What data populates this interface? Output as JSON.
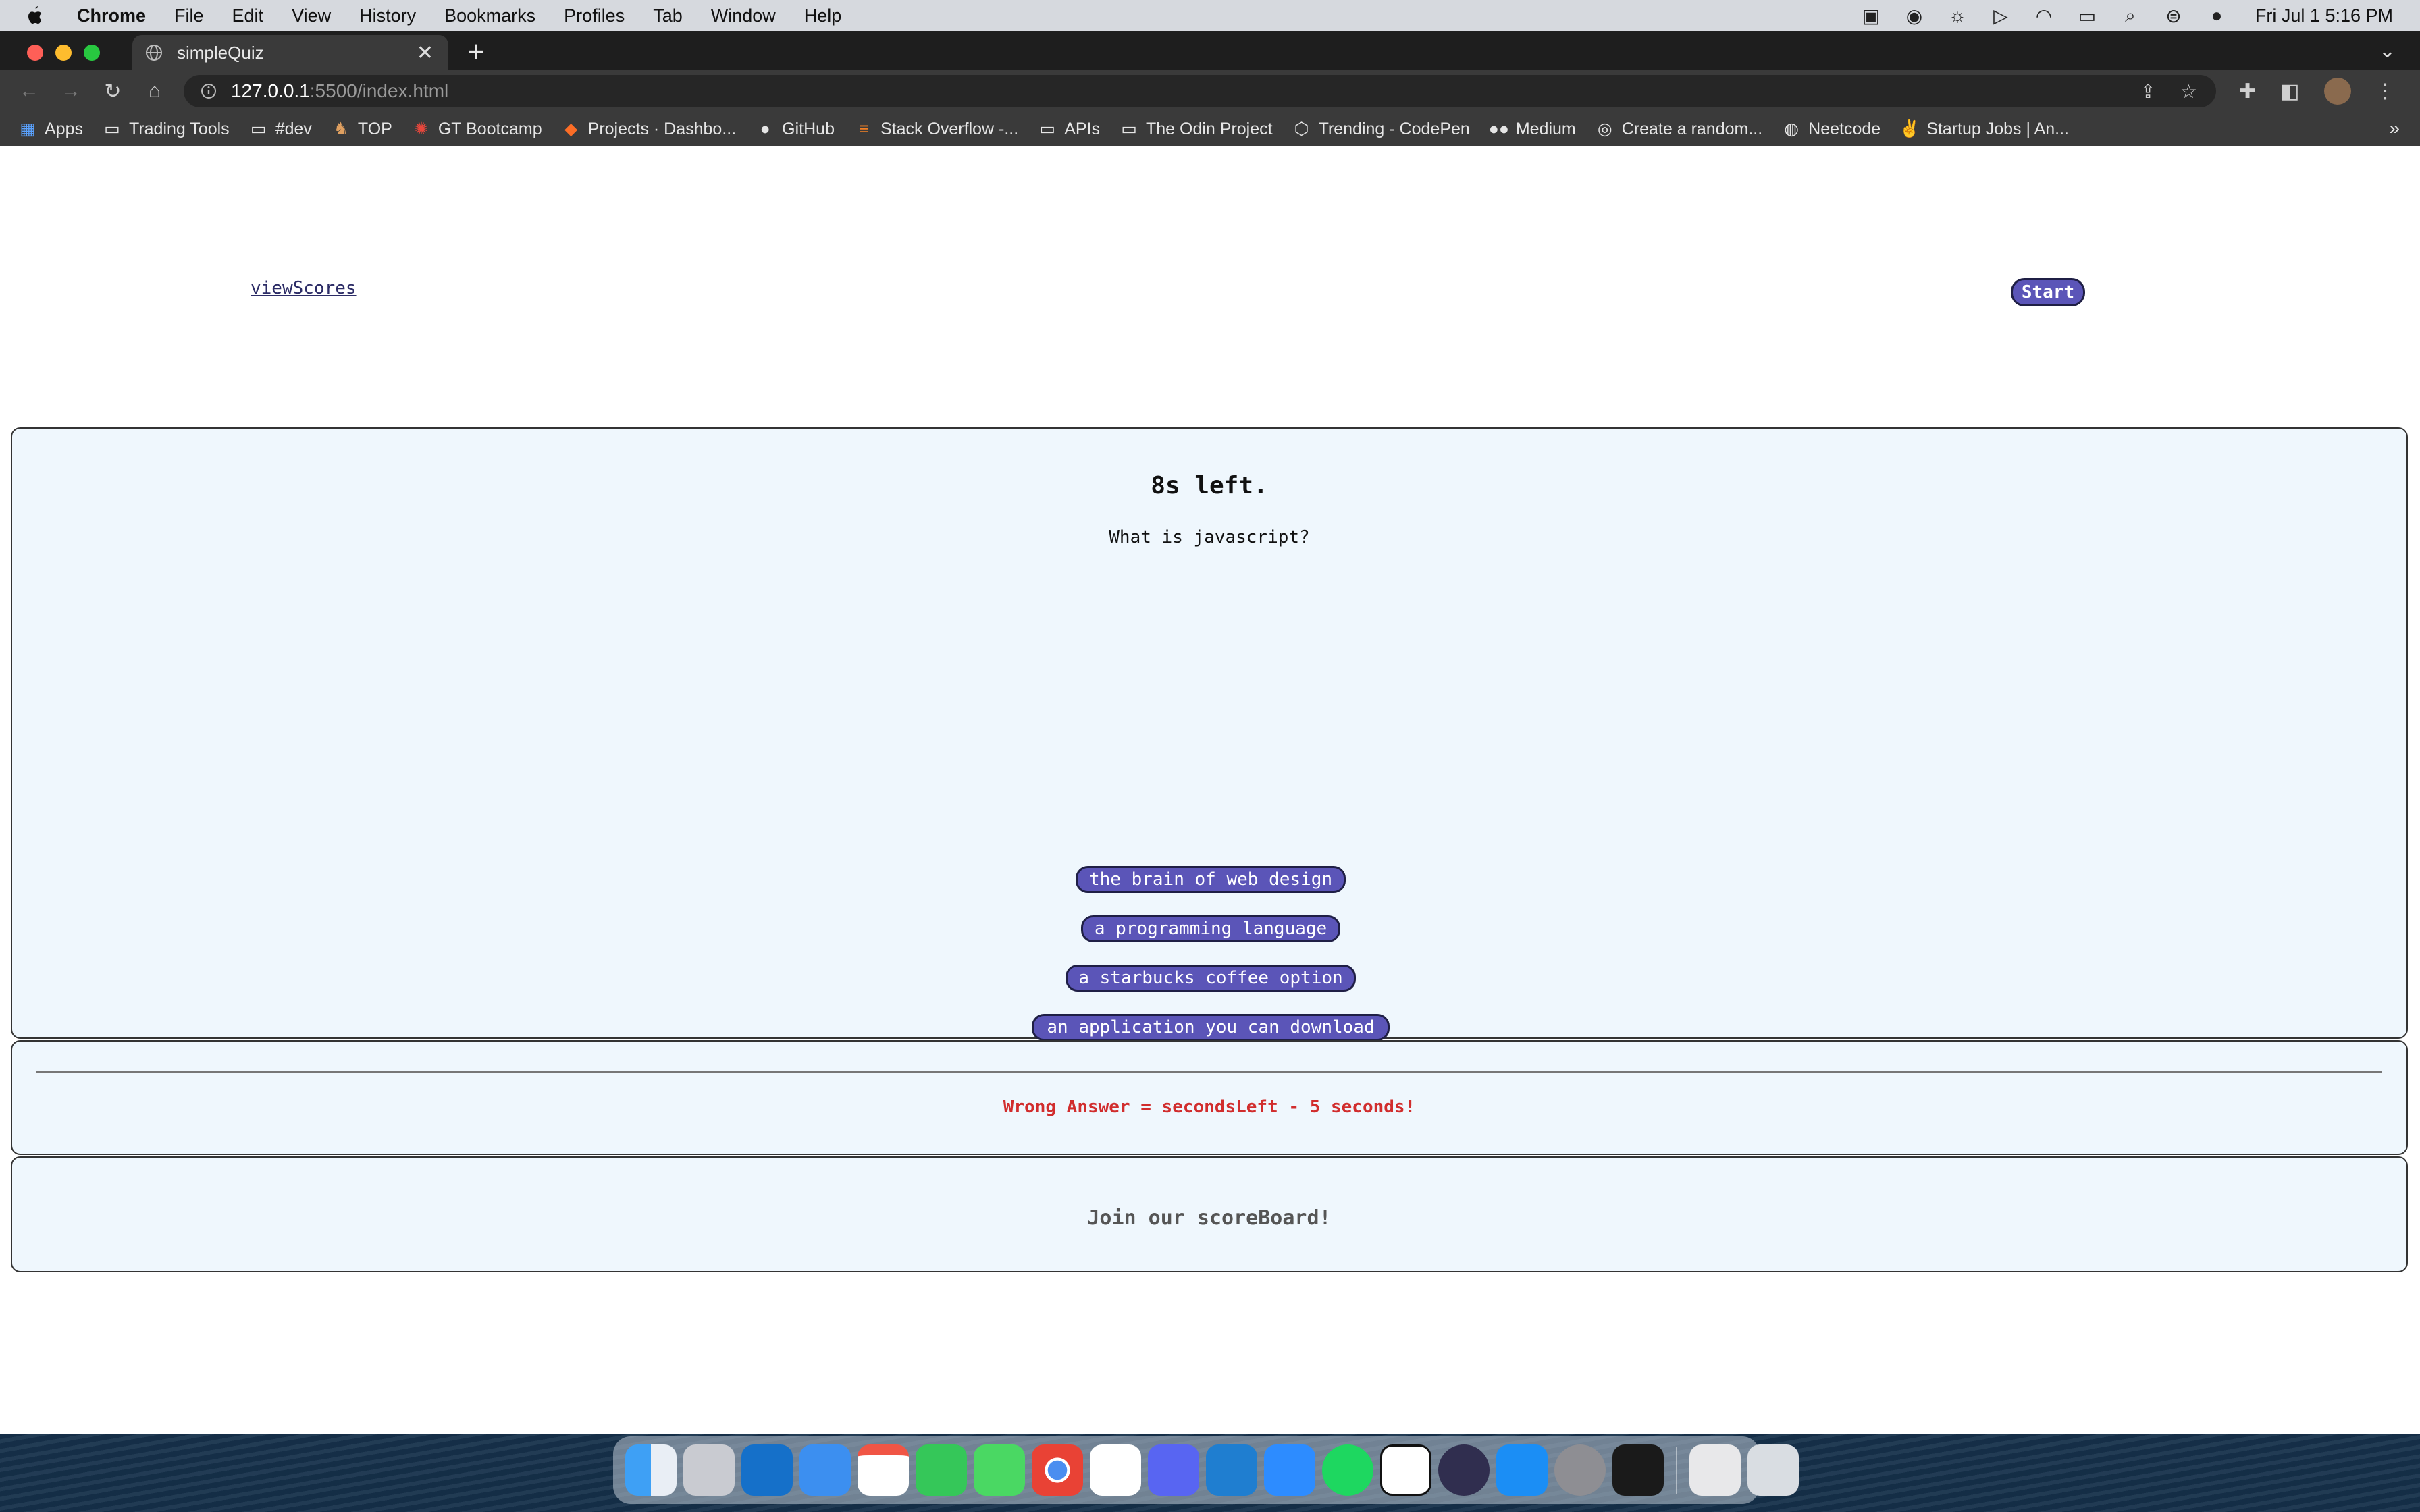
{
  "menubar": {
    "app": "Chrome",
    "items": [
      "File",
      "Edit",
      "View",
      "History",
      "Bookmarks",
      "Profiles",
      "Tab",
      "Window",
      "Help"
    ],
    "clock": "Fri Jul 1  5:16 PM"
  },
  "browser": {
    "tab_title": "simpleQuiz",
    "url_host": "127.0.0.1",
    "url_path": ":5500/index.html",
    "bookmarks": [
      {
        "label": "Apps",
        "icon": "apps-grid-icon"
      },
      {
        "label": "Trading Tools",
        "icon": "folder-icon"
      },
      {
        "label": "#dev",
        "icon": "folder-icon"
      },
      {
        "label": "TOP",
        "icon": "top-icon"
      },
      {
        "label": "GT Bootcamp",
        "icon": "gt-bootcamp-icon"
      },
      {
        "label": "Projects · Dashbo...",
        "icon": "gitlab-icon"
      },
      {
        "label": "GitHub",
        "icon": "github-icon"
      },
      {
        "label": "Stack Overflow -...",
        "icon": "stackoverflow-icon"
      },
      {
        "label": "APIs",
        "icon": "folder-icon"
      },
      {
        "label": "The Odin Project",
        "icon": "folder-icon"
      },
      {
        "label": "Trending - CodePen",
        "icon": "codepen-icon"
      },
      {
        "label": "Medium",
        "icon": "medium-icon"
      },
      {
        "label": "Create a random...",
        "icon": "globe-icon"
      },
      {
        "label": "Neetcode",
        "icon": "neetcode-icon"
      },
      {
        "label": "Startup Jobs | An...",
        "icon": "angellist-icon"
      }
    ]
  },
  "page": {
    "view_scores": "viewScores",
    "start": "Start",
    "timer": "8s left.",
    "question": "What is javascript?",
    "answers": [
      "the brain of web design",
      "a programming language",
      "a starbucks coffee option",
      "an application you can download"
    ],
    "feedback": "Wrong Answer = secondsLeft - 5 seconds!",
    "join": "Join our scoreBoard!"
  },
  "colors": {
    "button_bg": "#5b55b8",
    "panel_bg": "#eff7fd",
    "feedback_text": "#d12d2d"
  },
  "dock": [
    "finder-icon",
    "launchpad-icon",
    "outlook-icon",
    "mail-icon",
    "calendar-icon",
    "facetime-icon",
    "messages-icon",
    "chrome-icon",
    "slack-icon",
    "discord-icon",
    "vscode-icon",
    "zoom-icon",
    "spotify-icon",
    "notion-icon",
    "obs-icon",
    "app-store-icon",
    "system-settings-icon",
    "terminal-icon",
    "documents-icon",
    "trash-icon"
  ]
}
